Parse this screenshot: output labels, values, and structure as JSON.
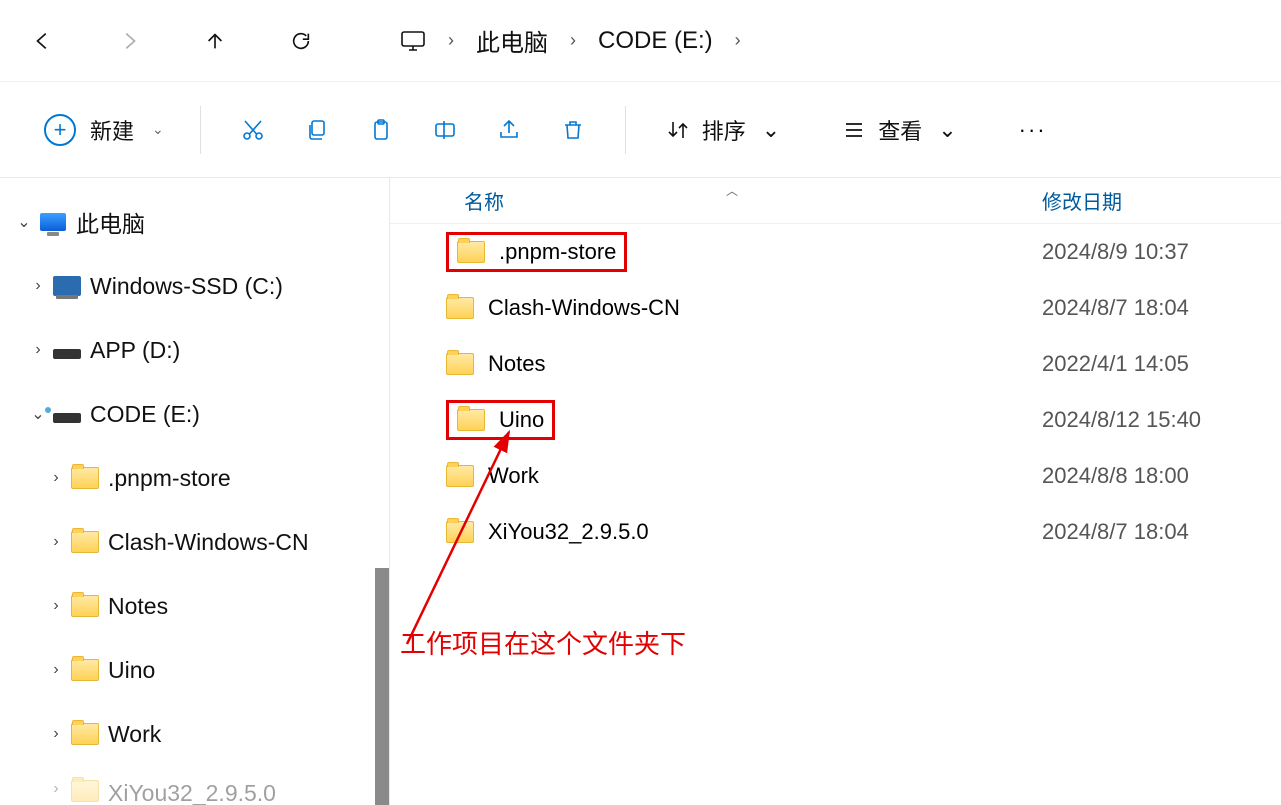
{
  "breadcrumb": {
    "root": "此电脑",
    "current": "CODE (E:)"
  },
  "toolbar": {
    "new_label": "新建",
    "sort_label": "排序",
    "view_label": "查看"
  },
  "sidebar": {
    "root": {
      "label": "此电脑"
    },
    "drives": [
      {
        "label": "Windows-SSD (C:)",
        "expanded": false
      },
      {
        "label": "APP (D:)",
        "expanded": false
      },
      {
        "label": "CODE (E:)",
        "expanded": true
      }
    ],
    "folders": [
      {
        "label": ".pnpm-store"
      },
      {
        "label": "Clash-Windows-CN"
      },
      {
        "label": "Notes"
      },
      {
        "label": "Uino"
      },
      {
        "label": "Work"
      },
      {
        "label": "XiYou32_2.9.5.0"
      }
    ]
  },
  "list": {
    "header_name": "名称",
    "header_date": "修改日期",
    "rows": [
      {
        "name": ".pnpm-store",
        "date": "2024/8/9 10:37",
        "highlighted": true
      },
      {
        "name": "Clash-Windows-CN",
        "date": "2024/8/7 18:04",
        "highlighted": false
      },
      {
        "name": "Notes",
        "date": "2022/4/1 14:05",
        "highlighted": false
      },
      {
        "name": "Uino",
        "date": "2024/8/12 15:40",
        "highlighted": true
      },
      {
        "name": "Work",
        "date": "2024/8/8 18:00",
        "highlighted": false
      },
      {
        "name": "XiYou32_2.9.5.0",
        "date": "2024/8/7 18:04",
        "highlighted": false
      }
    ]
  },
  "annotation": {
    "text": "工作项目在这个文件夹下"
  }
}
